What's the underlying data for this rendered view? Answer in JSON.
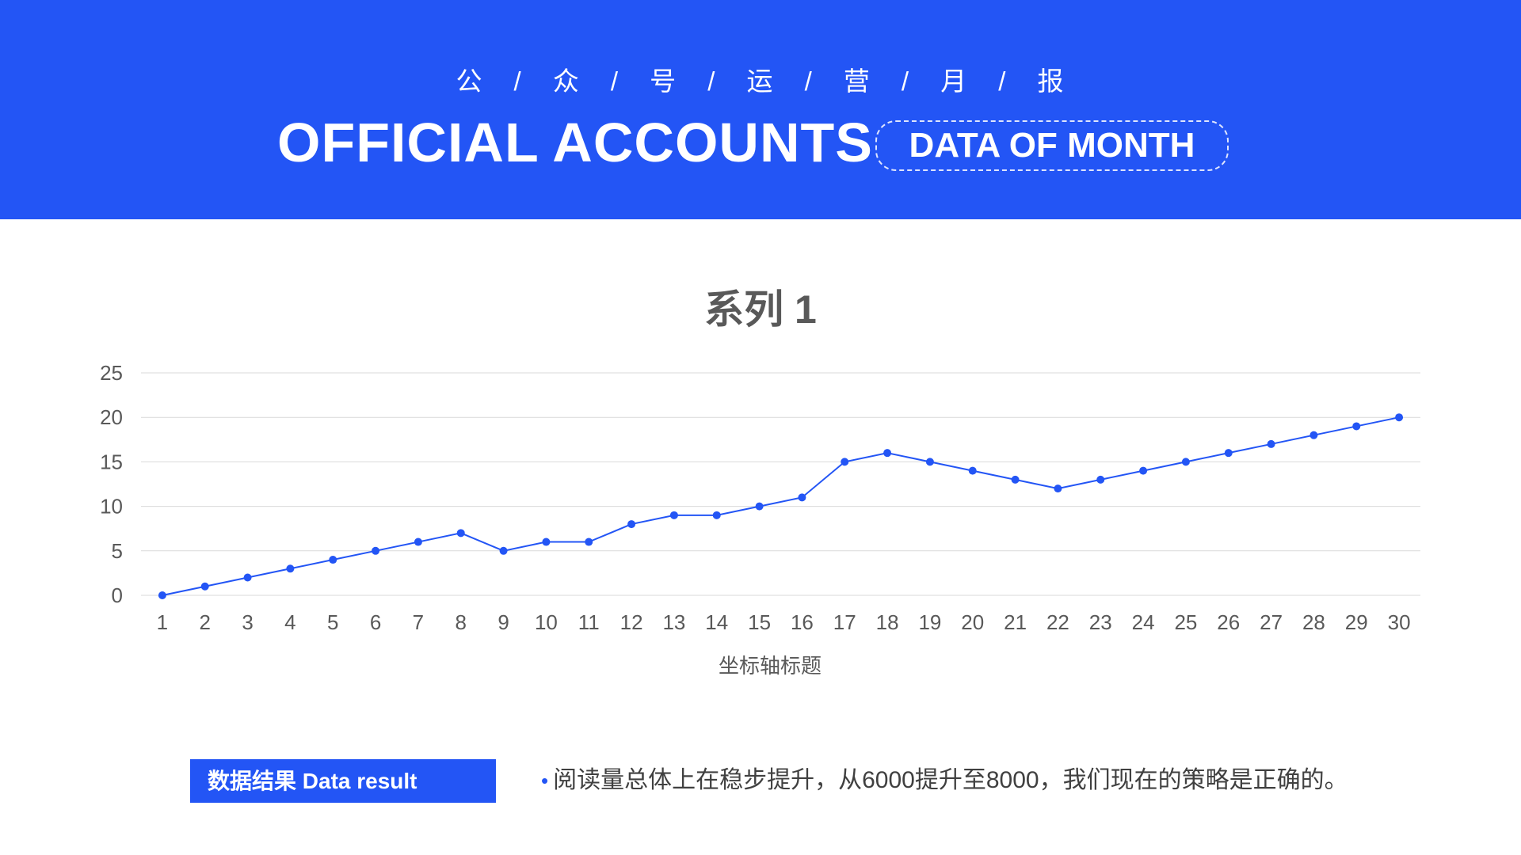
{
  "header": {
    "subtitle_chars": [
      "公",
      "众",
      "号",
      "运",
      "营",
      "月",
      "报"
    ],
    "subtitle_separator": "/",
    "title": "OFFICIAL ACCOUNTS",
    "badge": "DATA OF MONTH",
    "background_color": "#2355f5"
  },
  "chart_data": {
    "type": "line",
    "title": "系列 1",
    "xlabel": "坐标轴标题",
    "ylabel": "",
    "categories": [
      "1",
      "2",
      "3",
      "4",
      "5",
      "6",
      "7",
      "8",
      "9",
      "10",
      "11",
      "12",
      "13",
      "14",
      "15",
      "16",
      "17",
      "18",
      "19",
      "20",
      "21",
      "22",
      "23",
      "24",
      "25",
      "26",
      "27",
      "28",
      "29",
      "30"
    ],
    "series": [
      {
        "values": [
          0,
          1,
          2,
          3,
          4,
          5,
          6,
          7,
          5,
          6,
          6,
          8,
          9,
          9,
          10,
          11,
          15,
          16,
          15,
          14,
          13,
          12,
          13,
          14,
          15,
          16,
          17,
          18,
          19,
          20
        ],
        "color": "#2355f5",
        "marker": "circle"
      }
    ],
    "ylim": [
      0,
      25
    ],
    "yticks": [
      0,
      5,
      10,
      15,
      20,
      25
    ],
    "grid": true,
    "legend": "none"
  },
  "result": {
    "tag": "数据结果  Data result",
    "bullet": "•",
    "text": "阅读量总体上在稳步提升，从6000提升至8000，我们现在的策略是正确的。"
  }
}
